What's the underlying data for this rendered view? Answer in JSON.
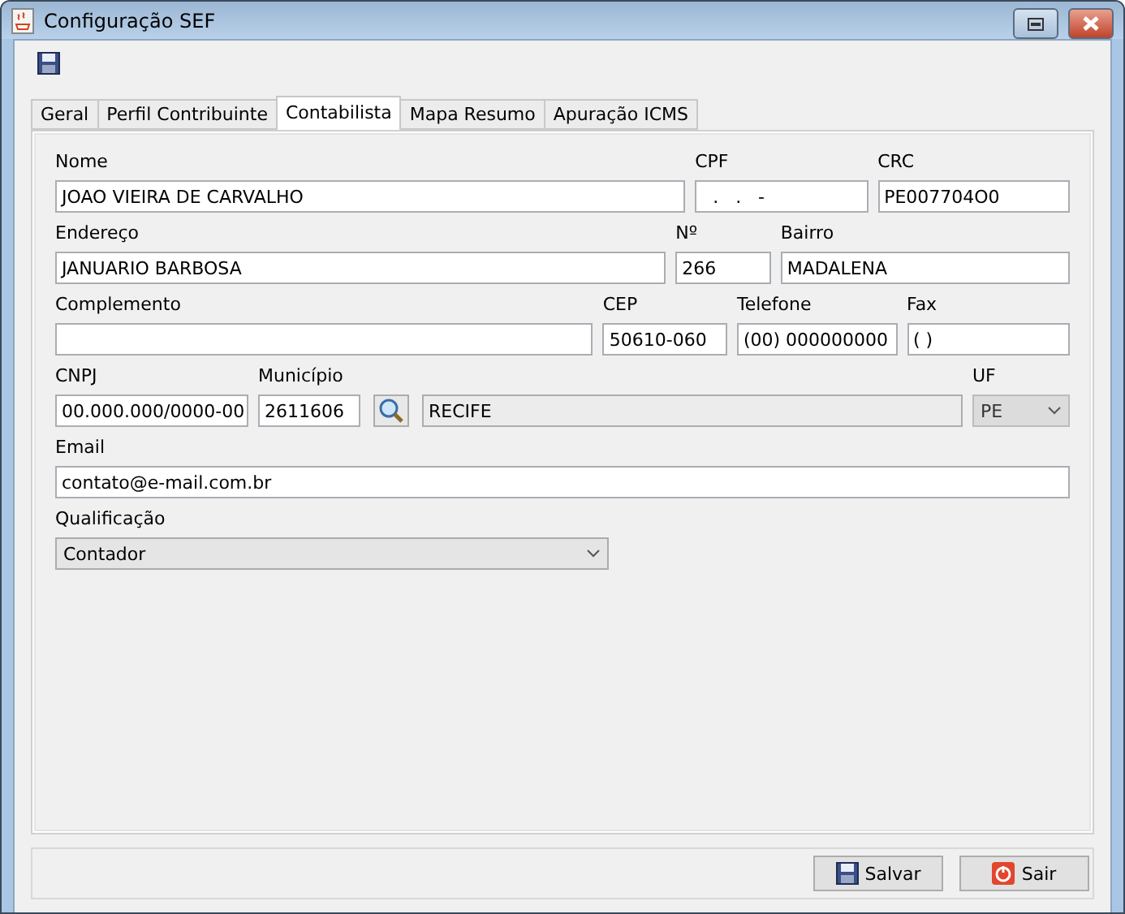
{
  "window": {
    "title": "Configuração SEF"
  },
  "tabs": [
    {
      "label": "Geral",
      "selected": false
    },
    {
      "label": "Perfil Contribuinte",
      "selected": false
    },
    {
      "label": "Contabilista",
      "selected": true
    },
    {
      "label": "Mapa Resumo",
      "selected": false
    },
    {
      "label": "Apuração ICMS",
      "selected": false
    }
  ],
  "form_rows": [
    [
      {
        "kind": "text",
        "label": "Nome",
        "value": "JOAO VIEIRA DE CARVALHO"
      },
      {
        "kind": "text",
        "label": "CPF",
        "value": "  .   .   -"
      },
      {
        "kind": "text",
        "label": "CRC",
        "value": "PE007704O0"
      }
    ],
    [
      {
        "kind": "text",
        "label": "Endereço",
        "value": "JANUARIO BARBOSA"
      },
      {
        "kind": "text",
        "label": "Nº",
        "value": "266"
      },
      {
        "kind": "text",
        "label": "Bairro",
        "value": "MADALENA"
      }
    ],
    [
      {
        "kind": "text",
        "label": "Complemento"
      },
      {
        "kind": "text",
        "label": "CEP",
        "value": "50610-060"
      },
      {
        "kind": "text",
        "label": "Telefone",
        "value": "(00) 000000000"
      },
      {
        "kind": "text",
        "label": "Fax",
        "value": "( )"
      }
    ],
    [
      {
        "kind": "text",
        "label": "CNPJ",
        "value": "00.000.000/0000-00"
      },
      {
        "kind": "text",
        "label": "Município",
        "value": "2611606"
      },
      {
        "kind": "lookup"
      },
      {
        "kind": "readonly",
        "value": "RECIFE"
      },
      {
        "kind": "combo",
        "label": "UF",
        "value": "PE",
        "disabled": true
      }
    ],
    [
      {
        "kind": "text",
        "label": "Email",
        "value": "contato@e-mail.com.br"
      }
    ],
    [
      {
        "kind": "combo",
        "label": "Qualificação",
        "value": "Contador",
        "disabled": false
      }
    ]
  ],
  "buttons": [
    {
      "kind": "save",
      "label": "Salvar"
    },
    {
      "kind": "exit",
      "label": "Sair"
    }
  ]
}
